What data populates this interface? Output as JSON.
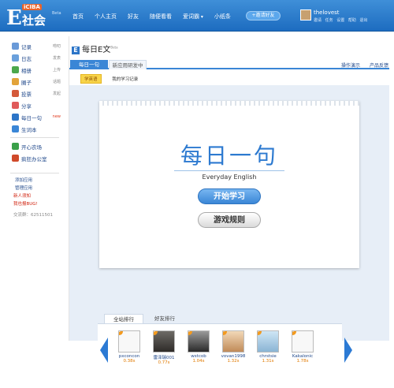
{
  "header": {
    "logo_brand": "iCIBA",
    "logo_text": "社会",
    "logo_beta": "Beta",
    "nav": [
      "首页",
      "个人主页",
      "好友",
      "随便看看",
      "爱词霸",
      "小纸条"
    ],
    "invite_label": "+邀请好友",
    "username": "thelovest",
    "user_links": [
      "邀请",
      "任务",
      "设置",
      "帮助",
      "退出"
    ]
  },
  "sidebar": {
    "items": [
      {
        "label": "记录",
        "extra": "唠叨",
        "icon": "notes-icon",
        "color": "#6a9ad8"
      },
      {
        "label": "日志",
        "extra": "发表",
        "icon": "journal-icon",
        "color": "#6aa0dc"
      },
      {
        "label": "相册",
        "extra": "上传",
        "icon": "album-icon",
        "color": "#4ca84c"
      },
      {
        "label": "圈子",
        "extra": "话题",
        "icon": "circle-icon",
        "color": "#e2a33a"
      },
      {
        "label": "投票",
        "extra": "发起",
        "icon": "vote-icon",
        "color": "#d45a3a"
      },
      {
        "label": "分享",
        "extra": "",
        "icon": "share-icon",
        "color": "#e05a5a"
      },
      {
        "label": "每日一句",
        "extra": "new",
        "icon": "daily-e-icon",
        "color": "#2c75c8"
      },
      {
        "label": "生词本",
        "extra": "",
        "icon": "wordbook-icon",
        "color": "#3a86d6"
      }
    ],
    "apps": [
      {
        "label": "开心农场",
        "icon": "farm-icon",
        "color": "#3aa04a"
      },
      {
        "label": "疯狂办公室",
        "icon": "office-icon",
        "color": "#d04a2a"
      }
    ],
    "links": [
      "添加应用",
      "管理应用"
    ],
    "red_links": [
      "新人须知",
      "我也报BUG!"
    ],
    "qq": "交流群：62511501"
  },
  "main": {
    "title": "每日E文",
    "title_beta": "Beta",
    "tabs": [
      "每日一句",
      "新应用研发中"
    ],
    "top_links": [
      "操作演示",
      "产品反馈"
    ],
    "subtabs": [
      "学英语",
      "我的学习记录"
    ]
  },
  "card": {
    "title": "每日一句",
    "subtitle": "Everyday English",
    "start_button": "开始学习",
    "rules_button": "游戏规则"
  },
  "ranking": {
    "tabs": [
      "全站排行",
      "好友排行"
    ],
    "entries": [
      {
        "rank": "1",
        "name": "pxconcon",
        "time": "0.38s"
      },
      {
        "rank": "2",
        "name": "雷泽瑞001",
        "time": "0.77s"
      },
      {
        "rank": "3",
        "name": "wstcob",
        "time": "1.04s"
      },
      {
        "rank": "4",
        "name": "vovan1998",
        "time": "1.32s"
      },
      {
        "rank": "5",
        "name": "chrstsie",
        "time": "1.31s"
      },
      {
        "rank": "6",
        "name": "Kakalonic",
        "time": "1.78s"
      }
    ]
  }
}
